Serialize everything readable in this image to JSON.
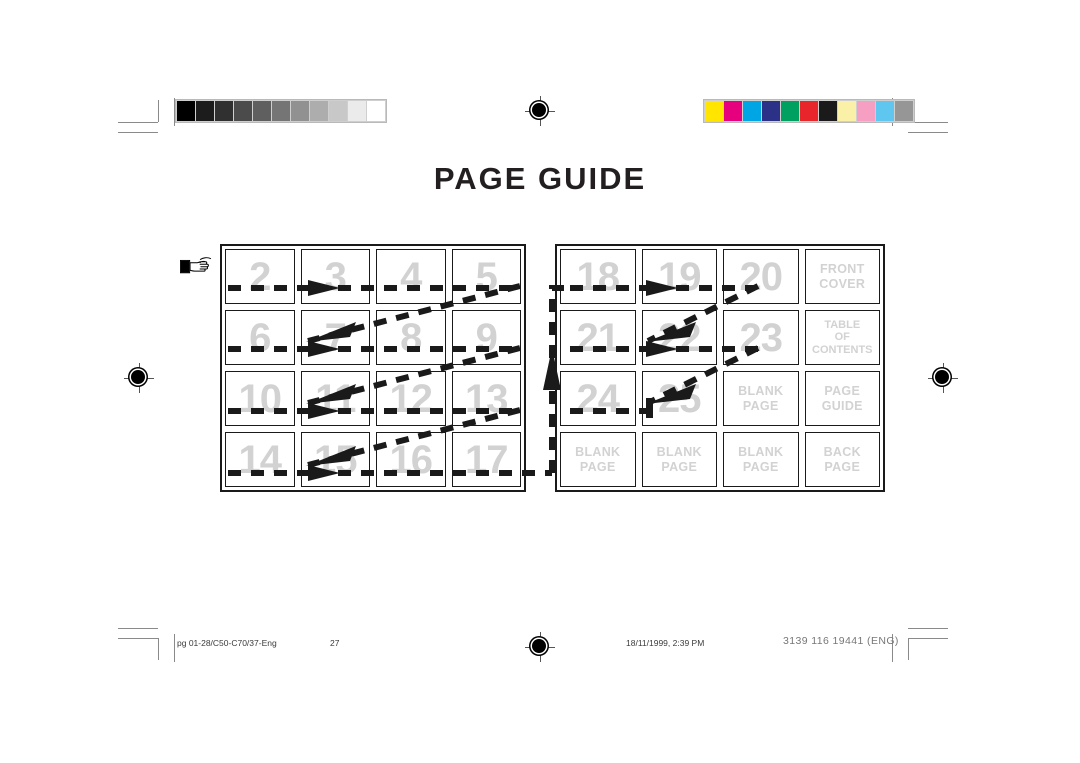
{
  "document": {
    "title": "PAGE GUIDE"
  },
  "calibration": {
    "grayscale_label": "grayscale-calibration-strip",
    "grayscale_patches": [
      "#000000",
      "#1c1c1c",
      "#303030",
      "#4b4b4b",
      "#5f5f5f",
      "#757575",
      "#919191",
      "#adadad",
      "#c8c8c8",
      "#ebebeb",
      "#ffffff"
    ],
    "color_label": "color-calibration-strip",
    "color_patches": [
      "#ffe500",
      "#e6007e",
      "#00a5e3",
      "#2b3187",
      "#00a160",
      "#e8252a",
      "#1a1a1a",
      "#fbf0a8",
      "#f79fc2",
      "#5fc6f0",
      "#969696"
    ]
  },
  "diagram": {
    "hand_icon": "pointing-hand-icon",
    "left_grid": {
      "name": "page-grid-left",
      "cells": [
        {
          "num": "2"
        },
        {
          "num": "3"
        },
        {
          "num": "4"
        },
        {
          "num": "5"
        },
        {
          "num": "6"
        },
        {
          "num": "7"
        },
        {
          "num": "8"
        },
        {
          "num": "9"
        },
        {
          "num": "10"
        },
        {
          "num": "11"
        },
        {
          "num": "12"
        },
        {
          "num": "13"
        },
        {
          "num": "14"
        },
        {
          "num": "15"
        },
        {
          "num": "16"
        },
        {
          "num": "17"
        }
      ]
    },
    "right_grid": {
      "name": "page-grid-right",
      "cells": [
        {
          "num": "18"
        },
        {
          "num": "19"
        },
        {
          "num": "20"
        },
        {
          "label": "FRONT\nCOVER"
        },
        {
          "num": "21"
        },
        {
          "num": "22"
        },
        {
          "num": "23"
        },
        {
          "label": "TABLE\nOF\nCONTENTS",
          "tight": true
        },
        {
          "num": "24"
        },
        {
          "num": "25"
        },
        {
          "label": "BLANK\nPAGE"
        },
        {
          "label": "PAGE\nGUIDE"
        },
        {
          "label": "BLANK\nPAGE"
        },
        {
          "label": "BLANK\nPAGE"
        },
        {
          "label": "BLANK\nPAGE"
        },
        {
          "label": "BACK\nPAGE"
        }
      ]
    },
    "flow_color": "#1a1a1a"
  },
  "footer": {
    "file_ref": "pg 01-28/C50-C70/37-Eng",
    "page_number": "27",
    "timestamp": "18/11/1999, 2:39 PM",
    "doc_code": "3139 116 19441 (ENG)"
  }
}
